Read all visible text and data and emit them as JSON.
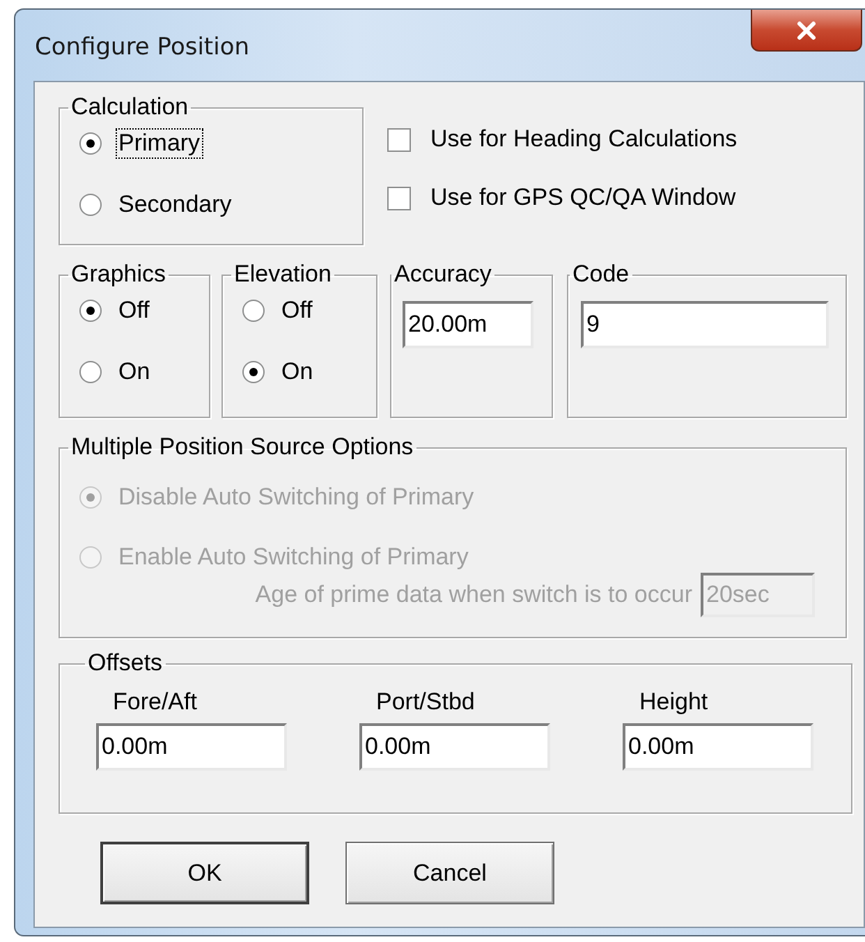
{
  "window": {
    "title": "Configure Position"
  },
  "calculation": {
    "label": "Calculation",
    "options": [
      {
        "label": "Primary",
        "selected": true,
        "focused": true
      },
      {
        "label": "Secondary",
        "selected": false,
        "focused": false
      }
    ]
  },
  "checkboxes": [
    {
      "label": "Use for Heading Calculations",
      "checked": false
    },
    {
      "label": "Use for GPS QC/QA Window",
      "checked": false
    }
  ],
  "graphics": {
    "label": "Graphics",
    "options": [
      {
        "label": "Off",
        "selected": true
      },
      {
        "label": "On",
        "selected": false
      }
    ]
  },
  "elevation": {
    "label": "Elevation",
    "options": [
      {
        "label": "Off",
        "selected": false
      },
      {
        "label": "On",
        "selected": true
      }
    ]
  },
  "accuracy": {
    "label": "Accuracy",
    "value": "20.00m"
  },
  "code": {
    "label": "Code",
    "value": "9"
  },
  "multiple_source": {
    "label": "Multiple Position Source Options",
    "disabled": true,
    "options": [
      {
        "label": "Disable Auto Switching of Primary",
        "selected": true
      },
      {
        "label": "Enable Auto Switching of Primary",
        "selected": false
      }
    ],
    "age": {
      "label": "Age of prime data when switch is to occur",
      "value": "20sec"
    }
  },
  "offsets": {
    "label": "Offsets",
    "fields": [
      {
        "label": "Fore/Aft",
        "value": "0.00m"
      },
      {
        "label": "Port/Stbd",
        "value": "0.00m"
      },
      {
        "label": "Height",
        "value": "0.00m"
      }
    ]
  },
  "buttons": [
    {
      "label": "OK",
      "default": true
    },
    {
      "label": "Cancel",
      "default": false
    }
  ]
}
